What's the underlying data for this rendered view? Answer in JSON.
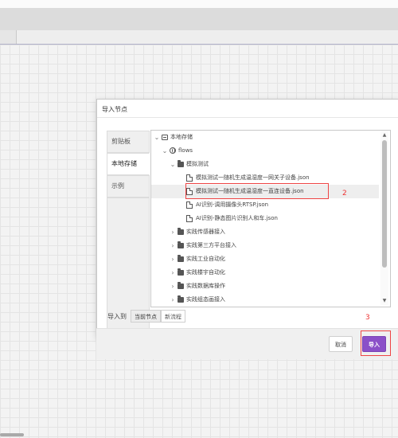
{
  "dialog": {
    "title": "导入节点"
  },
  "library_tabs": [
    {
      "label": "剪贴板",
      "active": false
    },
    {
      "label": "本地存储",
      "active": true
    },
    {
      "label": "示例",
      "active": false
    }
  ],
  "tree": {
    "root": "本地存储",
    "flows": "flows",
    "folder_sim": "模拟测试",
    "files": [
      "模拟测试一随机生成温湿度一网关子设备.json",
      "模拟测试一随机生成温湿度一直连设备.json",
      "AI识别-调用摄像头RTSP.json",
      "AI识别-静态图片识别人和车.json"
    ],
    "folders": [
      "实践传感器接入",
      "实践第三方平台接入",
      "实践工业自动化",
      "实践楼宇自动化",
      "实践数据库操作",
      "实践组态画接入"
    ]
  },
  "import_to": {
    "label": "导入到",
    "options": [
      "当前节点",
      "新流程"
    ],
    "selected": "当前节点"
  },
  "buttons": {
    "cancel": "取消",
    "import": "导入"
  },
  "annotations": [
    "2",
    "3"
  ],
  "colors": {
    "accent": "#8b50c8",
    "annotation": "#e44444"
  },
  "icons": {
    "expanded": "chevron-down-icon",
    "collapsed": "chevron-right-icon",
    "folder": "folder-icon",
    "file": "file-icon"
  }
}
